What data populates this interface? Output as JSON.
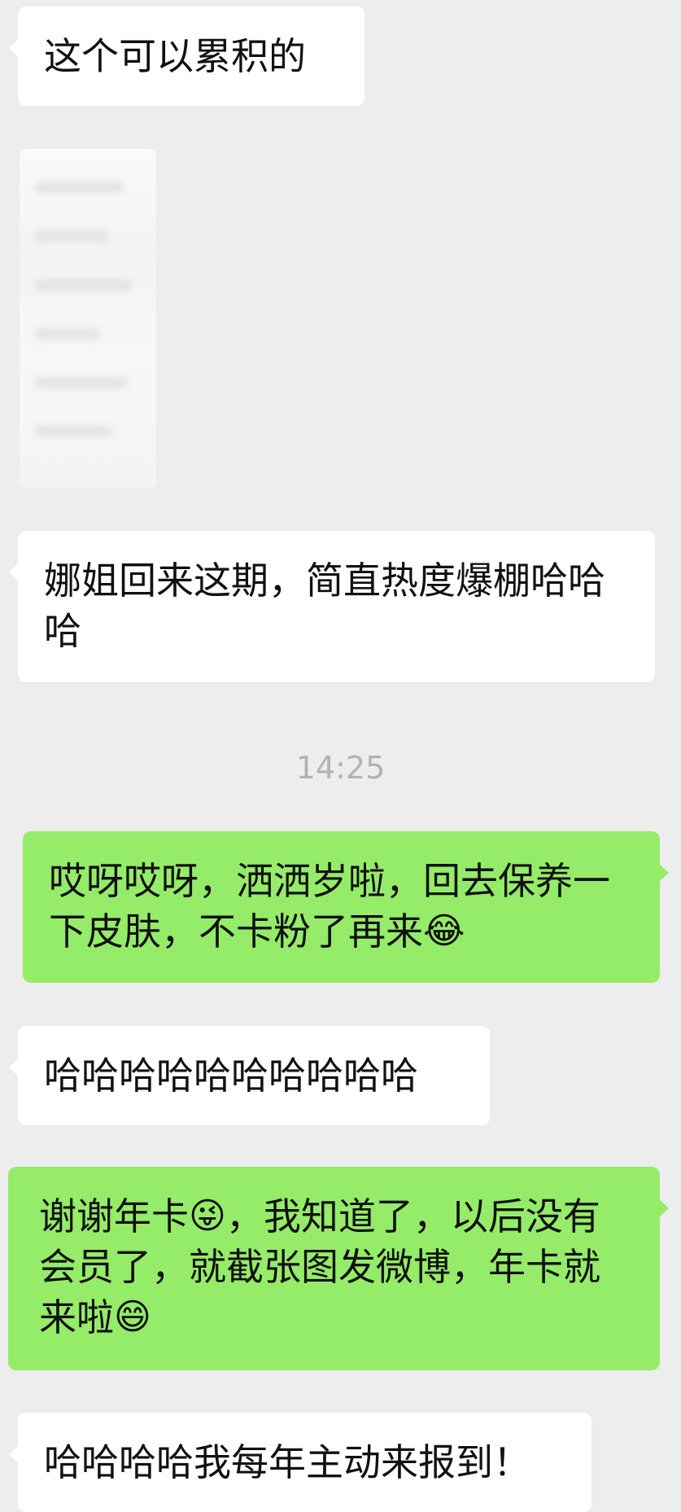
{
  "messages": [
    {
      "side": "in",
      "text": "这个可以累积的"
    },
    {
      "side": "in",
      "type": "image"
    },
    {
      "side": "in",
      "text": "娜姐回来这期，简直热度爆棚哈哈哈"
    },
    {
      "type": "timestamp",
      "text": "14:25"
    },
    {
      "side": "out",
      "text": "哎呀哎呀，洒洒岁啦，回去保养一下皮肤，不卡粉了再来",
      "emoji": "😂"
    },
    {
      "side": "in",
      "text": "哈哈哈哈哈哈哈哈哈哈"
    },
    {
      "side": "out",
      "text_a": "谢谢年卡",
      "emoji_a": "😜",
      "text_b": "，我知道了，以后没有会员了，就截张图发微博，年卡就来啦",
      "emoji_b": "😄"
    },
    {
      "side": "in",
      "text": "哈哈哈哈我每年主动来报到！"
    }
  ]
}
